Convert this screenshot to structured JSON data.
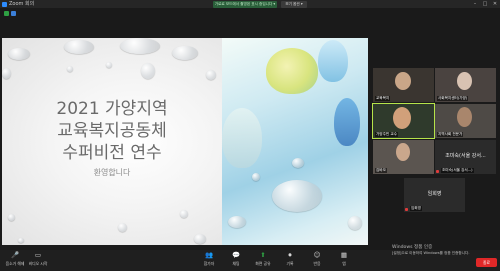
{
  "window": {
    "title": "Zoom 회의",
    "banner": "가로로 모드에서 촬영된 표시 중입니다 ▾",
    "banner_button": "보기 옵션 ▾",
    "controls": {
      "minimize": "–",
      "maximize": "□",
      "close": "✕"
    }
  },
  "slide": {
    "title_lines": [
      "2021 가양지역",
      "교육복지공동체",
      "수퍼비전 연수"
    ],
    "subtitle": "환영합니다"
  },
  "gallery": {
    "tiles": [
      {
        "label": "교육복지"
      },
      {
        "label": "사회복지센터(가양)"
      },
      {
        "label": "가양주민 교수"
      },
      {
        "label": "지역사회 전문가"
      },
      {
        "label": "김바오"
      },
      {
        "label": "조미숙(서울 강서...)",
        "big": "조미숙(서울 강서..."
      },
      {
        "label": "",
        "big": "임희영"
      },
      {
        "label": "임희영"
      }
    ]
  },
  "toolbar": {
    "items": [
      {
        "icon": "microphone-icon",
        "glyph": "🎤",
        "label": "음소거 해제"
      },
      {
        "icon": "video-icon",
        "glyph": "▭",
        "label": "비디오 시작"
      },
      {
        "icon": "participants-icon",
        "glyph": "👥",
        "label": "참가자"
      },
      {
        "icon": "chat-icon",
        "glyph": "💬",
        "label": "채팅"
      },
      {
        "icon": "share-screen-icon",
        "glyph": "⬆",
        "label": "화면 공유"
      },
      {
        "icon": "record-icon",
        "glyph": "⏺",
        "label": "기록"
      },
      {
        "icon": "reactions-icon",
        "glyph": "☺",
        "label": "반응"
      },
      {
        "icon": "apps-icon",
        "glyph": "▦",
        "label": "앱"
      }
    ],
    "end_label": "종료"
  },
  "watermark": {
    "line1": "Windows 정품 인증",
    "line2": "[설정]으로 이동하여 Windows를 정품 인증합니다."
  },
  "colors": {
    "accent_green": "#b6e34a",
    "end_red": "#e02828",
    "zoom_blue": "#2d8cff"
  }
}
